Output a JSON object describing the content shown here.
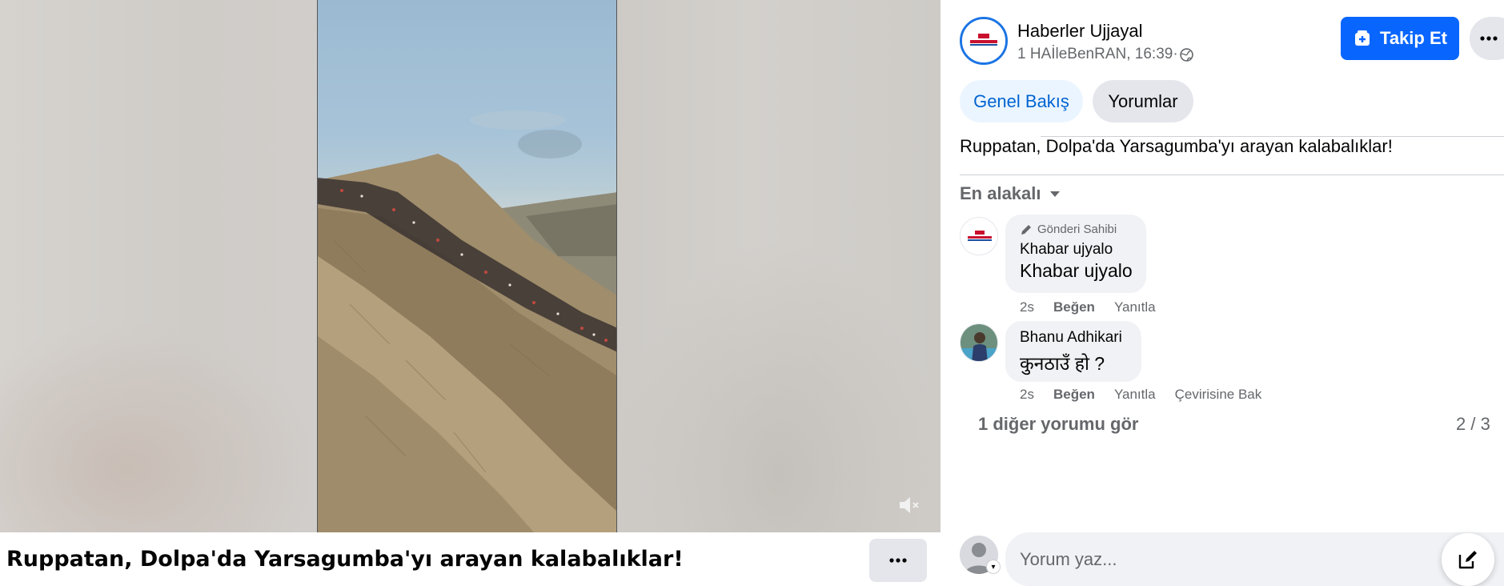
{
  "post": {
    "title": "Ruppatan, Dolpa'da Yarsagumba'yı arayan kalabalıklar!",
    "text": "Ruppatan, Dolpa'da Yarsagumba'yı arayan kalabalıklar!"
  },
  "page": {
    "name": "Haberler Ujjayal",
    "meta": "1 HAİleBenRAN, 16:39·",
    "follow_label": "Takip Et"
  },
  "tabs": [
    {
      "label": "Genel Bakış",
      "active": true
    },
    {
      "label": "Yorumlar",
      "active": false
    }
  ],
  "sort": {
    "label": "En alakalı"
  },
  "comments": [
    {
      "badge": "Gönderi Sahibi",
      "author": "Khabar ujyalo",
      "text": "Khabar ujyalo",
      "time": "2s",
      "like": "Beğen",
      "reply": "Yanıtla"
    },
    {
      "author": "Bhanu Adhikari",
      "text": "कुनठाउँ हो ?",
      "time": "2s",
      "like": "Beğen",
      "reply": "Yanıtla",
      "translate": "Çevirisine Bak"
    }
  ],
  "more_comments": "1 diğer yorumu gör",
  "pager": "2 / 3",
  "composer": {
    "placeholder": "Yorum yaz..."
  },
  "colors": {
    "brand": "#0866ff",
    "tab_active_bg": "#ebf5ff",
    "tab_active_text": "#0064d1",
    "muted": "#65676b"
  },
  "icons": {
    "mute": "speaker-muted-icon",
    "globe": "globe-icon",
    "follow": "add-page-icon",
    "more": "ellipsis-icon",
    "sort": "caret-down-icon",
    "badge": "pen-icon",
    "compose": "edit-icon"
  }
}
